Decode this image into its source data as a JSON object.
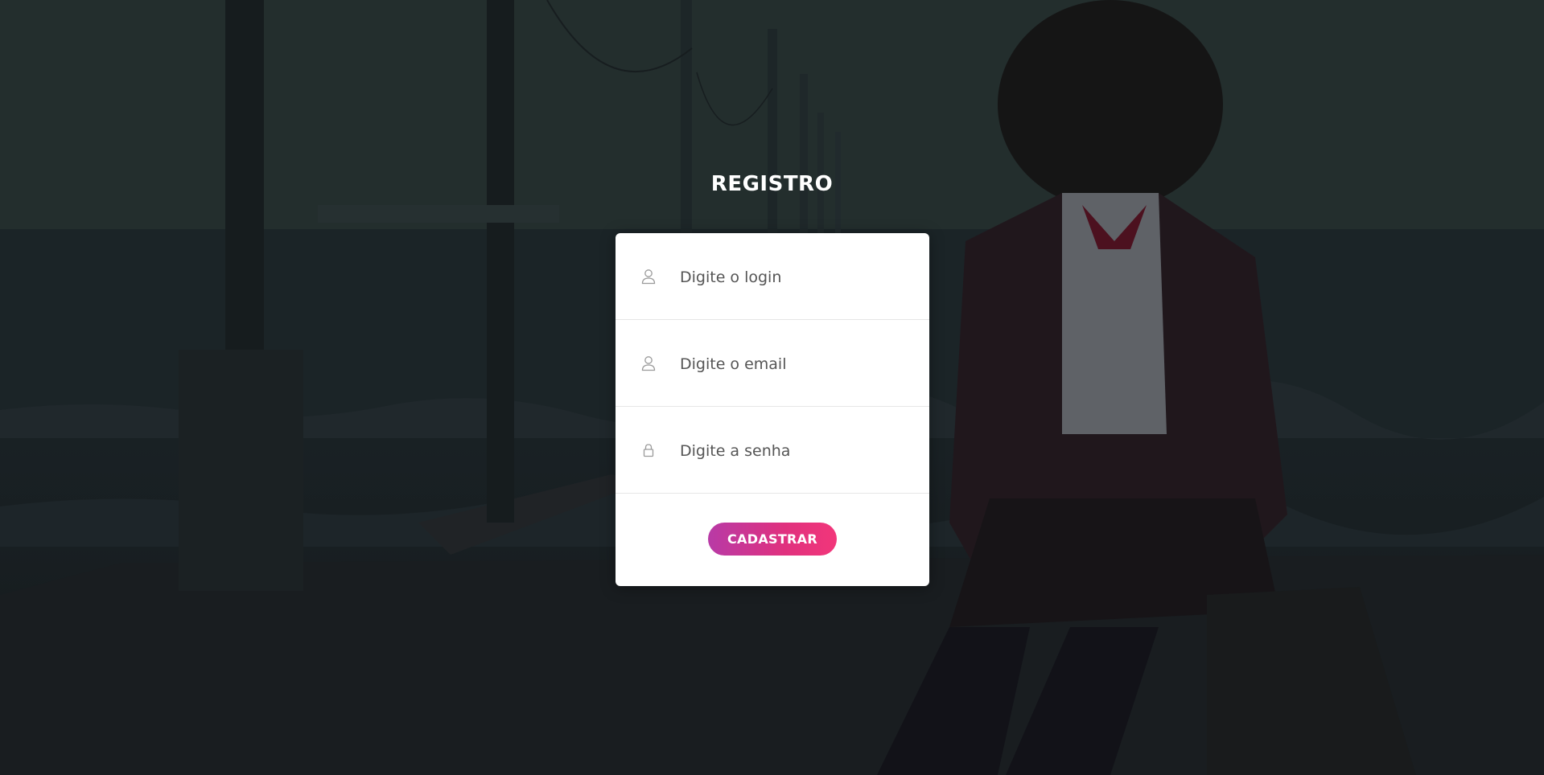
{
  "page": {
    "title": "REGISTRO"
  },
  "form": {
    "fields": [
      {
        "name": "login",
        "placeholder": "Digite o login",
        "icon": "user-icon",
        "type": "text"
      },
      {
        "name": "email",
        "placeholder": "Digite o email",
        "icon": "user-icon",
        "type": "text"
      },
      {
        "name": "senha",
        "placeholder": "Digite a senha",
        "icon": "lock-icon",
        "type": "password"
      }
    ],
    "submit_label": "CADASTRAR"
  },
  "colors": {
    "card_bg": "#ffffff",
    "button_gradient_start": "#b83aa6",
    "button_gradient_end": "#f2367a",
    "title_text": "#ffffff"
  }
}
